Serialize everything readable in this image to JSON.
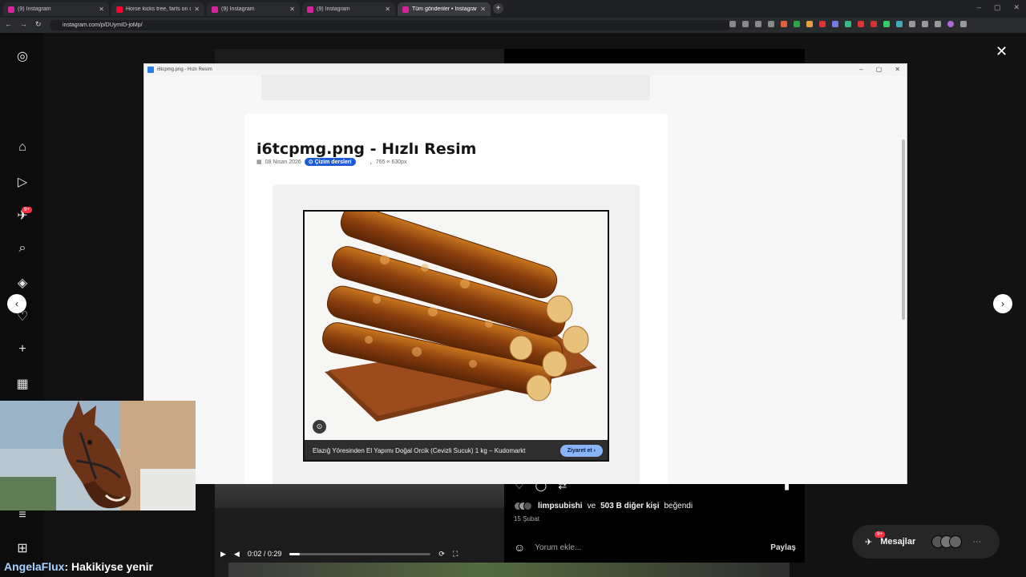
{
  "browser": {
    "tabs": [
      {
        "label": "(9) Instagram",
        "icon": "instagram-icon",
        "active": false
      },
      {
        "label": "Horse kicks tree, farts on dog...",
        "icon": "youtube-icon",
        "active": false
      },
      {
        "label": "(9) Instagram",
        "icon": "instagram-icon",
        "active": false
      },
      {
        "label": "(9) Instagram",
        "icon": "instagram-icon",
        "active": false
      },
      {
        "label": "Tüm gönderiler • Instagram",
        "icon": "instagram-icon",
        "active": true
      }
    ],
    "url": "instagram.com/p/DUymID-joMp/"
  },
  "instagram": {
    "likes": {
      "user": "limpsubishi",
      "conj": "ve",
      "others": "503 B diğer kişi",
      "verb": "beğendi"
    },
    "date": "15 Şubat",
    "comment_placeholder": "Yorum ekle...",
    "post_label": "Paylaş",
    "messages_label": "Mesajlar",
    "messages_badge": "9+",
    "sidebar_badge": "9+",
    "video": {
      "time": "0:02 / 0:29",
      "progress": 0.07
    }
  },
  "viewer": {
    "window_title": "i6tcpmg.png - Hızlı Resim",
    "page_title": "i6tcpmg.png - Hızlı Resim",
    "date": "08 Nisan 2026",
    "category": "Çizim dersleri",
    "dimensions": "765 × 630px",
    "image_caption": "Elazığ Yöresinden El Yapımı Doğal Orcik (Cevizli Sucuk) 1 kg – Kudomarkt",
    "visit_label": "Ziyaret et"
  },
  "overlay": {
    "name": "AngelaFlux",
    "text": ": Hakikiyse yenir"
  }
}
